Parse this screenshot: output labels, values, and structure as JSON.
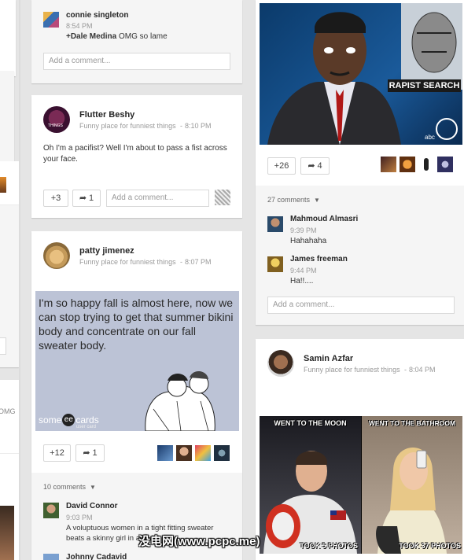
{
  "left_column": {
    "comment_snippet": "OMG"
  },
  "card1": {
    "comment": {
      "author": "connie singleton",
      "time": "8:54 PM",
      "mention": "+Dale Medina",
      "text": " OMG so lame"
    },
    "add_comment_placeholder": "Add a comment..."
  },
  "card2": {
    "author": "Flutter Beshy",
    "community": "Funny place for funniest things",
    "time": "8:10 PM",
    "body": "Oh I'm a pacifist? Well I'm about to pass a fist across your face.",
    "plus_count": "+3",
    "share_count": "1",
    "add_comment_placeholder": "Add a comment..."
  },
  "card3": {
    "author": "patty jimenez",
    "community": "Funny place for funniest things",
    "time": "8:07 PM",
    "ecard_text": "I'm so happy fall is almost here, now we can stop trying to get that summer bikini body and concentrate on our fall sweater body.",
    "ecard_brand_left": "some",
    "ecard_brand_mid": "ee",
    "ecard_brand_right": "cards",
    "ecard_brand_sub": "user card",
    "plus_count": "+12",
    "share_count": "1",
    "comments_count": "10 comments",
    "comments": [
      {
        "author": "David Connor",
        "time": "9:03 PM",
        "text": "A voluptuous women in a tight fitting sweater beats a skinny girl in a bikini"
      },
      {
        "author": "Johnny Cadavid",
        "time": "",
        "text": ""
      }
    ]
  },
  "card4": {
    "image_caption": "RAPIST SEARCH",
    "image_logo": "abc",
    "plus_count": "+26",
    "share_count": "4",
    "comments_count": "27 comments",
    "comments": [
      {
        "author": "Mahmoud Almasri",
        "time": "9:39 PM",
        "text": "Hahahaha"
      },
      {
        "author": "James freeman",
        "time": "9:44 PM",
        "text": "Ha!!...."
      }
    ],
    "add_comment_placeholder": "Add a comment..."
  },
  "card5": {
    "author": "Samin Azfar",
    "community": "Funny place for funniest things",
    "time": "8:04 PM",
    "left_top": "WENT TO THE MOON",
    "left_bottom": "TOOK 5 PHOTOS",
    "right_top": "WENT TO THE BATHROOM",
    "right_bottom": "TOOK 37 PHOTOS"
  },
  "watermark": "没电网(www.pcpc.me)",
  "colors": {
    "background": "#e5e5e5",
    "accent_blue": "#4285f4",
    "meta_grey": "#999999"
  }
}
